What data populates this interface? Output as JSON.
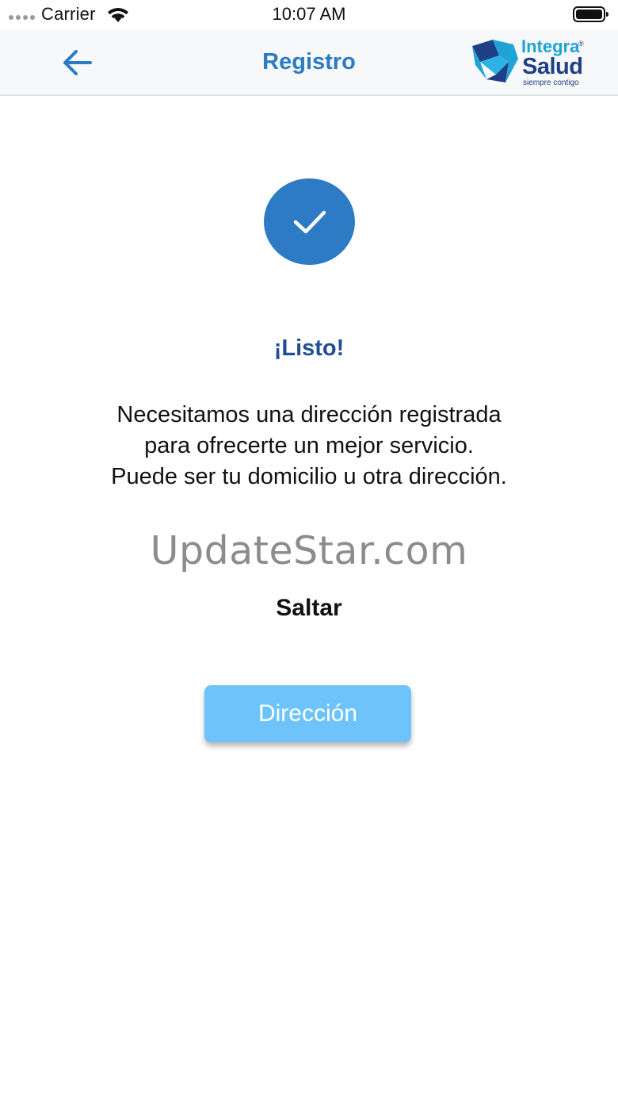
{
  "status_bar": {
    "carrier": "Carrier",
    "time": "10:07 AM"
  },
  "nav": {
    "title": "Registro",
    "logo": {
      "word_top": "Integra",
      "registered": "®",
      "word_main": "Salud",
      "tagline": "siempre contigo"
    }
  },
  "content": {
    "icon": "checkmark-icon",
    "heading": "¡Listo!",
    "message_lines": [
      "Necesitamos una dirección registrada",
      "para ofrecerte un mejor servicio.",
      "Puede ser tu domicilio u otra dirección."
    ],
    "watermark": "UpdateStar.com",
    "skip_label": "Saltar",
    "address_button_label": "Dirección"
  },
  "colors": {
    "accent": "#2b7bc4",
    "badge": "#2e7bc5",
    "heading": "#1f4e93",
    "button": "#6ec3fb"
  }
}
